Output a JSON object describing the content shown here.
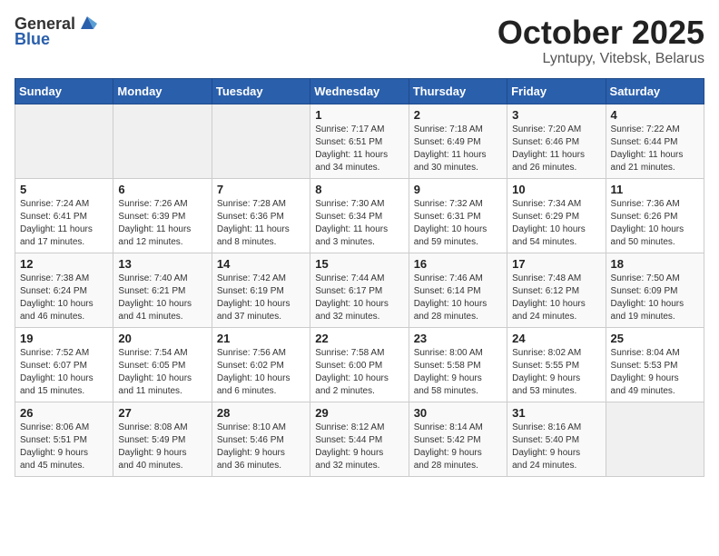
{
  "header": {
    "logo_line1": "General",
    "logo_line2": "Blue",
    "month_title": "October 2025",
    "location": "Lyntupy, Vitebsk, Belarus"
  },
  "weekdays": [
    "Sunday",
    "Monday",
    "Tuesday",
    "Wednesday",
    "Thursday",
    "Friday",
    "Saturday"
  ],
  "weeks": [
    [
      {
        "day": "",
        "info": ""
      },
      {
        "day": "",
        "info": ""
      },
      {
        "day": "",
        "info": ""
      },
      {
        "day": "1",
        "info": "Sunrise: 7:17 AM\nSunset: 6:51 PM\nDaylight: 11 hours\nand 34 minutes."
      },
      {
        "day": "2",
        "info": "Sunrise: 7:18 AM\nSunset: 6:49 PM\nDaylight: 11 hours\nand 30 minutes."
      },
      {
        "day": "3",
        "info": "Sunrise: 7:20 AM\nSunset: 6:46 PM\nDaylight: 11 hours\nand 26 minutes."
      },
      {
        "day": "4",
        "info": "Sunrise: 7:22 AM\nSunset: 6:44 PM\nDaylight: 11 hours\nand 21 minutes."
      }
    ],
    [
      {
        "day": "5",
        "info": "Sunrise: 7:24 AM\nSunset: 6:41 PM\nDaylight: 11 hours\nand 17 minutes."
      },
      {
        "day": "6",
        "info": "Sunrise: 7:26 AM\nSunset: 6:39 PM\nDaylight: 11 hours\nand 12 minutes."
      },
      {
        "day": "7",
        "info": "Sunrise: 7:28 AM\nSunset: 6:36 PM\nDaylight: 11 hours\nand 8 minutes."
      },
      {
        "day": "8",
        "info": "Sunrise: 7:30 AM\nSunset: 6:34 PM\nDaylight: 11 hours\nand 3 minutes."
      },
      {
        "day": "9",
        "info": "Sunrise: 7:32 AM\nSunset: 6:31 PM\nDaylight: 10 hours\nand 59 minutes."
      },
      {
        "day": "10",
        "info": "Sunrise: 7:34 AM\nSunset: 6:29 PM\nDaylight: 10 hours\nand 54 minutes."
      },
      {
        "day": "11",
        "info": "Sunrise: 7:36 AM\nSunset: 6:26 PM\nDaylight: 10 hours\nand 50 minutes."
      }
    ],
    [
      {
        "day": "12",
        "info": "Sunrise: 7:38 AM\nSunset: 6:24 PM\nDaylight: 10 hours\nand 46 minutes."
      },
      {
        "day": "13",
        "info": "Sunrise: 7:40 AM\nSunset: 6:21 PM\nDaylight: 10 hours\nand 41 minutes."
      },
      {
        "day": "14",
        "info": "Sunrise: 7:42 AM\nSunset: 6:19 PM\nDaylight: 10 hours\nand 37 minutes."
      },
      {
        "day": "15",
        "info": "Sunrise: 7:44 AM\nSunset: 6:17 PM\nDaylight: 10 hours\nand 32 minutes."
      },
      {
        "day": "16",
        "info": "Sunrise: 7:46 AM\nSunset: 6:14 PM\nDaylight: 10 hours\nand 28 minutes."
      },
      {
        "day": "17",
        "info": "Sunrise: 7:48 AM\nSunset: 6:12 PM\nDaylight: 10 hours\nand 24 minutes."
      },
      {
        "day": "18",
        "info": "Sunrise: 7:50 AM\nSunset: 6:09 PM\nDaylight: 10 hours\nand 19 minutes."
      }
    ],
    [
      {
        "day": "19",
        "info": "Sunrise: 7:52 AM\nSunset: 6:07 PM\nDaylight: 10 hours\nand 15 minutes."
      },
      {
        "day": "20",
        "info": "Sunrise: 7:54 AM\nSunset: 6:05 PM\nDaylight: 10 hours\nand 11 minutes."
      },
      {
        "day": "21",
        "info": "Sunrise: 7:56 AM\nSunset: 6:02 PM\nDaylight: 10 hours\nand 6 minutes."
      },
      {
        "day": "22",
        "info": "Sunrise: 7:58 AM\nSunset: 6:00 PM\nDaylight: 10 hours\nand 2 minutes."
      },
      {
        "day": "23",
        "info": "Sunrise: 8:00 AM\nSunset: 5:58 PM\nDaylight: 9 hours\nand 58 minutes."
      },
      {
        "day": "24",
        "info": "Sunrise: 8:02 AM\nSunset: 5:55 PM\nDaylight: 9 hours\nand 53 minutes."
      },
      {
        "day": "25",
        "info": "Sunrise: 8:04 AM\nSunset: 5:53 PM\nDaylight: 9 hours\nand 49 minutes."
      }
    ],
    [
      {
        "day": "26",
        "info": "Sunrise: 8:06 AM\nSunset: 5:51 PM\nDaylight: 9 hours\nand 45 minutes."
      },
      {
        "day": "27",
        "info": "Sunrise: 8:08 AM\nSunset: 5:49 PM\nDaylight: 9 hours\nand 40 minutes."
      },
      {
        "day": "28",
        "info": "Sunrise: 8:10 AM\nSunset: 5:46 PM\nDaylight: 9 hours\nand 36 minutes."
      },
      {
        "day": "29",
        "info": "Sunrise: 8:12 AM\nSunset: 5:44 PM\nDaylight: 9 hours\nand 32 minutes."
      },
      {
        "day": "30",
        "info": "Sunrise: 8:14 AM\nSunset: 5:42 PM\nDaylight: 9 hours\nand 28 minutes."
      },
      {
        "day": "31",
        "info": "Sunrise: 8:16 AM\nSunset: 5:40 PM\nDaylight: 9 hours\nand 24 minutes."
      },
      {
        "day": "",
        "info": ""
      }
    ]
  ]
}
